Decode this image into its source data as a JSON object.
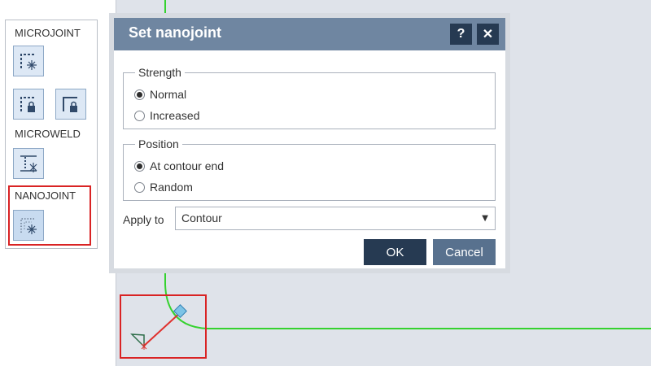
{
  "tool_panel": {
    "groups": [
      {
        "label": "MICROJOINT"
      },
      {
        "label": "MICROWELD"
      },
      {
        "label": "NANOJOINT"
      }
    ],
    "icons": [
      "microjoint-icon",
      "microjoint-lock-icon",
      "microjoint-lock-alt-icon",
      "microweld-icon",
      "nanojoint-icon"
    ]
  },
  "dialog": {
    "title": "Set nanojoint",
    "help_label": "?",
    "close_label": "✕",
    "strength": {
      "legend": "Strength",
      "options": [
        "Normal",
        "Increased"
      ],
      "selected": "Normal"
    },
    "position": {
      "legend": "Position",
      "options": [
        "At contour end",
        "Random"
      ],
      "selected": "At contour end"
    },
    "apply_to": {
      "label": "Apply to",
      "value": "Contour"
    },
    "ok_label": "OK",
    "cancel_label": "Cancel"
  },
  "colors": {
    "titlebar": "#6f86a1",
    "primary_button": "#263a52",
    "secondary_button": "#58718e",
    "highlight": "#d92324",
    "contour": "#35d22f",
    "nanojoint_marker": "#e0312e",
    "handle": "#7cc3e6"
  }
}
